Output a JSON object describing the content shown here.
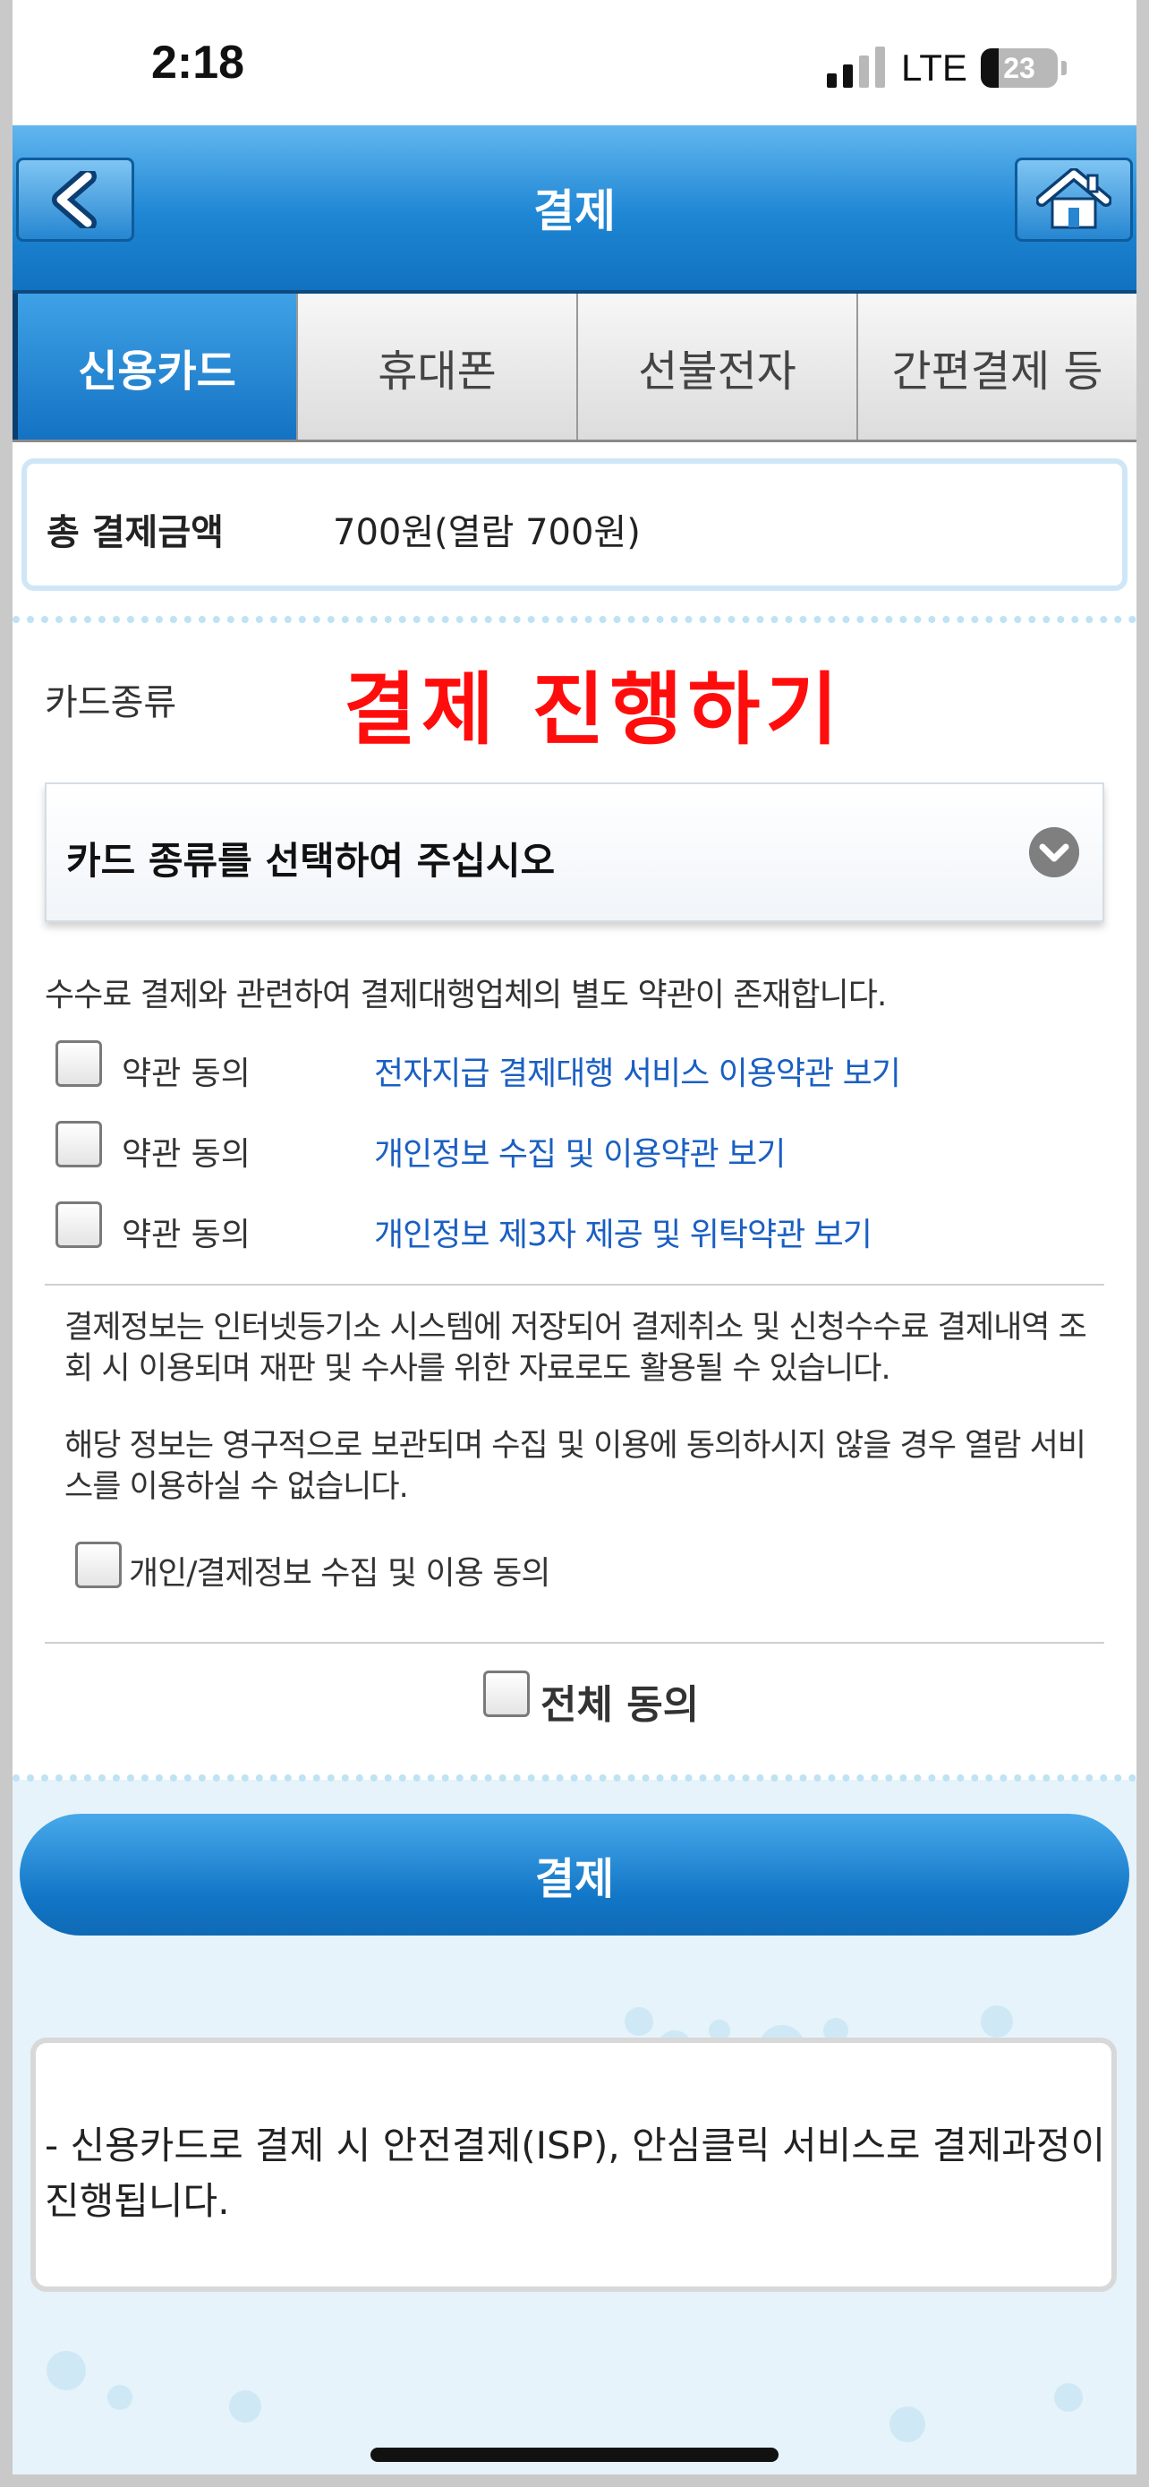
{
  "status_bar": {
    "time": "2:18",
    "network": "LTE",
    "battery": "23",
    "battery_level": 0.23,
    "signal_bars_active": 2
  },
  "header": {
    "title": "결제",
    "back_icon": "chevron-left-icon",
    "home_icon": "home-icon",
    "accent_color": "#1e86d4"
  },
  "tabs": [
    {
      "label": "신용카드",
      "active": true
    },
    {
      "label": "휴대폰",
      "active": false
    },
    {
      "label": "선불전자",
      "active": false
    },
    {
      "label": "간편결제 등",
      "active": false
    }
  ],
  "amount": {
    "label": "총 결제금액",
    "value": "700원(열람 700원)"
  },
  "card_type": {
    "label": "카드종류",
    "overlay_text": "결제 진행하기",
    "overlay_color": "#ff0d0d",
    "select_label": "카드 종류를 선택하여 주십시오"
  },
  "terms": {
    "notice": "수수료 결제와 관련하여 결제대행업체의 별도 약관이 존재합니다.",
    "items": [
      {
        "label": "약관 동의",
        "link": "전자지급 결제대행 서비스 이용약관 보기",
        "checked": false
      },
      {
        "label": "약관 동의",
        "link": "개인정보 수집 및 이용약관 보기",
        "checked": false
      },
      {
        "label": "약관 동의",
        "link": "개인정보 제3자 제공 및 위탁약관 보기",
        "checked": false
      }
    ]
  },
  "privacy": {
    "para1": "결제정보는 인터넷등기소 시스템에 저장되어 결제취소 및 신청수수료 결제내역 조회 시 이용되며 재판 및 수사를 위한 자료로도 활용될 수 있습니다.",
    "para2": "해당 정보는 영구적으로 보관되며 수집 및 이용에 동의하시지 않을 경우 열람 서비스를 이용하실 수 없습니다.",
    "consent_label": "개인/결제정보 수집 및 이용 동의",
    "consent_checked": false
  },
  "all_agree": {
    "label": "전체 동의",
    "checked": false
  },
  "pay_button": {
    "label": "결제"
  },
  "info": {
    "text": "- 신용카드로 결제 시 안전결제(ISP), 안심클릭 서비스로 결제과정이 진행됩니다."
  }
}
